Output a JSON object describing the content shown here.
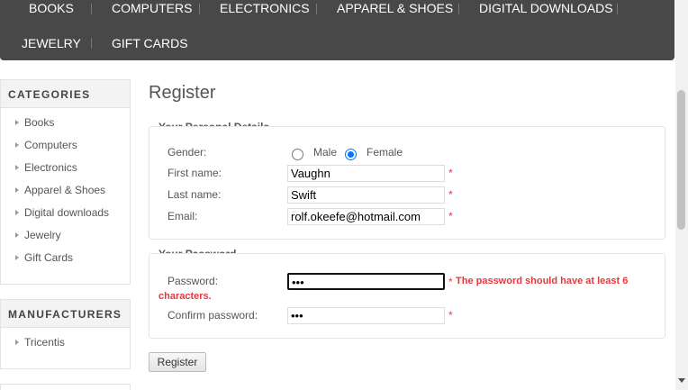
{
  "nav": {
    "row1": [
      "BOOKS",
      "COMPUTERS",
      "ELECTRONICS",
      "APPAREL & SHOES",
      "DIGITAL DOWNLOADS"
    ],
    "row2": [
      "JEWELRY",
      "GIFT CARDS"
    ]
  },
  "sidebar": {
    "categories_title": "CATEGORIES",
    "categories": [
      "Books",
      "Computers",
      "Electronics",
      "Apparel & Shoes",
      "Digital downloads",
      "Jewelry",
      "Gift Cards"
    ],
    "manufacturers_title": "MANUFACTURERS",
    "manufacturers": [
      "Tricentis"
    ]
  },
  "main": {
    "title": "Register",
    "personal": {
      "title": "Your Personal Details",
      "gender_label": "Gender:",
      "male": "Male",
      "female": "Female",
      "selected_gender": "Female",
      "first_name_label": "First name:",
      "first_name": "Vaughn",
      "last_name_label": "Last name:",
      "last_name": "Swift",
      "email_label": "Email:",
      "email": "rolf.okeefe@hotmail.com"
    },
    "password": {
      "title": "Your Password",
      "password_label": "Password:",
      "password_mask": "•••",
      "error_line1": "The password should have at least 6",
      "error_line2": "characters.",
      "confirm_label": "Confirm password:",
      "confirm_mask": "•••"
    },
    "required_mark": "*",
    "register_button": "Register"
  },
  "colors": {
    "nav_bg": "#484848",
    "error": "#e4393c",
    "radio_accent": "#0075ff"
  }
}
